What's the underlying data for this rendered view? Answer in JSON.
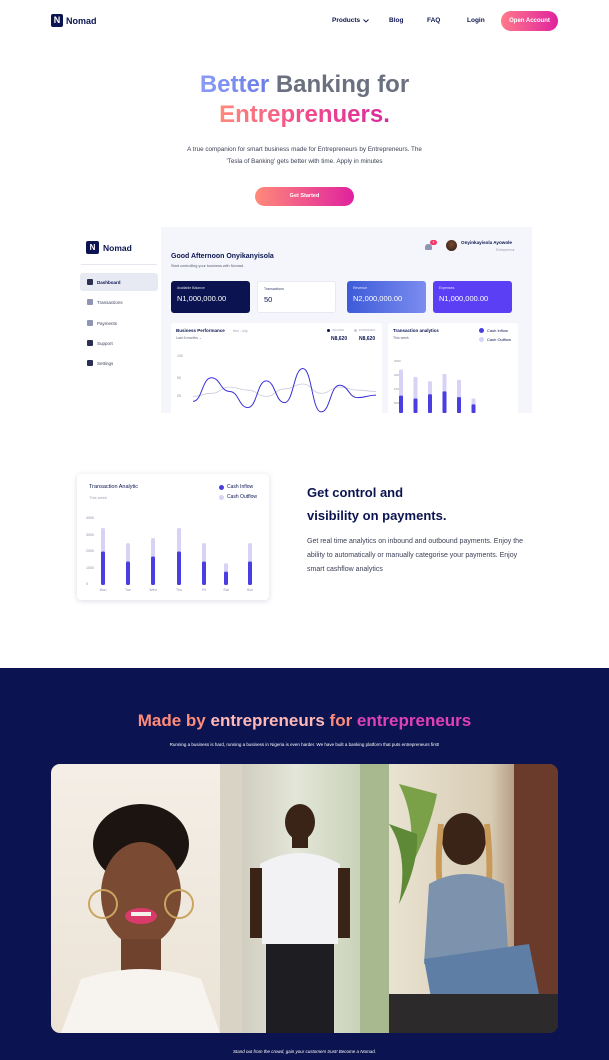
{
  "nav": {
    "logo_letter": "N",
    "logo_text": "Nomad",
    "products": "Products",
    "blog": "Blog",
    "faq": "FAQ",
    "login": "Login",
    "open_account": "Open Account"
  },
  "hero": {
    "title_part1": "Better",
    "title_part2": "Banking for",
    "title_line2": "Entreprenuers.",
    "desc_line1": "A true companion for smart business made for Entrepreneurs  by Entrepreneurs. The",
    "desc_line2": "'Tesla of Banking' gets better with time.  Apply in minutes",
    "cta": "Get Started"
  },
  "dashboard": {
    "logo_letter": "N",
    "logo_text": "Nomad",
    "sidebar": [
      "Dashboard",
      "Transactions",
      "Payments",
      "Support",
      "Settings"
    ],
    "greeting": "Good Afternoon Onyikanyisola",
    "greeting_sub": "Start controlling your business with Nomad.",
    "notification_count": "2",
    "user_name": "Onyinkayisola Ayowole",
    "user_role": "Entrepreneur",
    "cards": [
      {
        "label": "Available Balance",
        "value": "N1,000,000.00"
      },
      {
        "label": "Transactions",
        "value": "50"
      },
      {
        "label": "Revenue",
        "value": "N2,000,000.00"
      },
      {
        "label": "Expenses",
        "value": "N1,000,000.00"
      }
    ],
    "performance": {
      "title": "Business Performance",
      "title_sub": "Nov - July",
      "period": "Last 6 months",
      "legend_income": "INCOME",
      "legend_expenses": "EXPENSES",
      "income_value": "N8,620",
      "expenses_value": "N8,620",
      "y_ticks": [
        "100",
        "50",
        "25"
      ]
    },
    "analytics": {
      "title": "Transaction analytics",
      "sub": "This week",
      "legend_inflow": "Cash Inflow",
      "legend_outflow": "Cash Outflow",
      "y_ticks": [
        "3000",
        "2000",
        "1000",
        "500"
      ]
    }
  },
  "feature": {
    "card_title": "Transaction Analytic",
    "card_sub": "This week",
    "legend_inflow": "Cash Inflow",
    "legend_outflow": "Cash Outflow",
    "y_ticks": [
      "4000",
      "3000",
      "2000",
      "1000",
      "0"
    ],
    "x_labels": [
      "Mon",
      "Tue",
      "Wed",
      "Thu",
      "Fri",
      "Sat",
      "Sun"
    ],
    "heading_line1": "Get control and",
    "heading_line2": "visibility on payments.",
    "desc": "Get real time analytics on inbound and outbound payments. Enjoy the ability to automatically or manually categorise your payments. Enjoy smart cashflow analytics"
  },
  "chart_data": [
    {
      "type": "line",
      "title": "Business Performance",
      "series": [
        {
          "name": "INCOME",
          "values": [
            22,
            60,
            38,
            12,
            55,
            20,
            75,
            5,
            48,
            28,
            32
          ]
        },
        {
          "name": "EXPENSES",
          "values": [
            30,
            35,
            45,
            40,
            30,
            42,
            50,
            35,
            45,
            40,
            38
          ]
        }
      ],
      "ylim": [
        0,
        100
      ]
    },
    {
      "type": "bar",
      "title": "Transaction analytics",
      "series": [
        {
          "name": "Cash Inflow",
          "values": [
            1200,
            1000,
            1300,
            1500,
            1100,
            600
          ]
        },
        {
          "name": "Cash Outflow",
          "values": [
            3000,
            2500,
            2200,
            2700,
            2300,
            1000
          ]
        }
      ],
      "ylim": [
        0,
        3600
      ]
    },
    {
      "type": "bar",
      "title": "Transaction Analytic",
      "categories": [
        "Mon",
        "Tue",
        "Wed",
        "Thu",
        "Fri",
        "Sat",
        "Sun"
      ],
      "series": [
        {
          "name": "Cash Inflow",
          "values": [
            2000,
            1400,
            1700,
            2000,
            1400,
            800,
            1400
          ]
        },
        {
          "name": "Cash Outflow",
          "values": [
            3400,
            2500,
            2800,
            3400,
            2500,
            1300,
            2500
          ]
        }
      ],
      "ylim": [
        0,
        4000
      ]
    }
  ],
  "section": {
    "title_part1": "Made by ",
    "title_part2": "entrepreneurs",
    "title_part3": " for ",
    "title_part4": "entrepreneurs",
    "desc": "Running a business is hard, running a business in Nigeria is even harder. We have built a banking platform that puts entrepreneurs first!",
    "footer": "Stand out from the crowd, gain your customers trust! Become a Nomad."
  },
  "colors": {
    "navy": "#0b1450",
    "pink": "#e0229e",
    "purple": "#4a3ee0",
    "lavender": "#d6d3f7"
  }
}
